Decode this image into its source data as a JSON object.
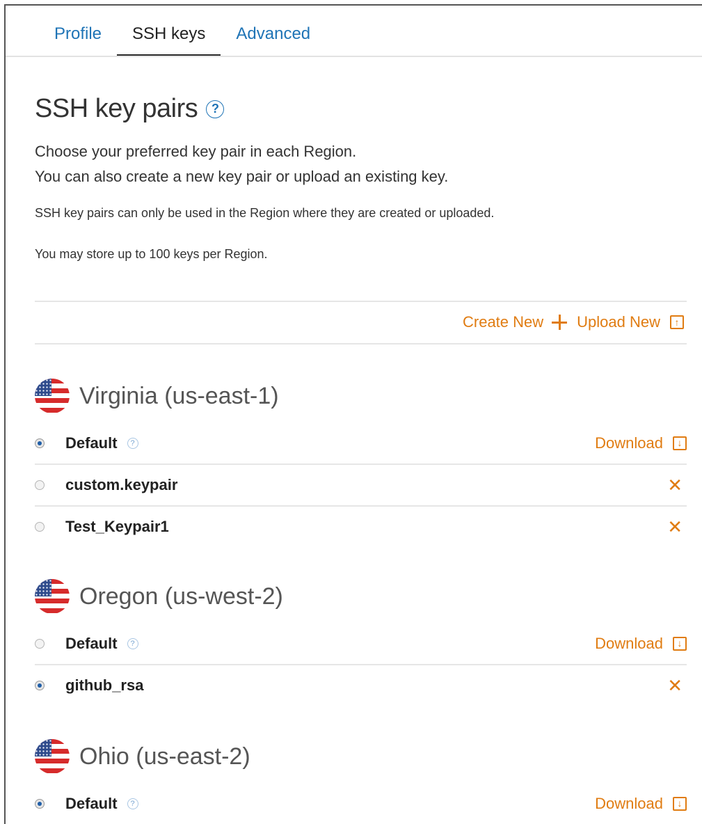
{
  "tabs": [
    {
      "label": "Profile",
      "active": false
    },
    {
      "label": "SSH keys",
      "active": true
    },
    {
      "label": "Advanced",
      "active": false
    }
  ],
  "header": {
    "title": "SSH key pairs",
    "help_glyph": "?",
    "intro_line1": "Choose your preferred key pair in each Region.",
    "intro_line2": "You can also create a new key pair or upload an existing key.",
    "note1": "SSH key pairs can only be used in the Region where they are created or uploaded.",
    "note2": "You may store up to 100 keys per Region."
  },
  "actions": {
    "create_label": "Create New",
    "upload_label": "Upload New"
  },
  "icons": {
    "plus": "plus-icon",
    "upload": "upload-icon",
    "download": "download-icon",
    "delete": "close-icon",
    "flag": "us-flag-icon",
    "help": "help-icon"
  },
  "colors": {
    "accent": "#e07c12",
    "link": "#1f74b6",
    "radio_selected": "#1f5ea8"
  },
  "regions": [
    {
      "name": "Virginia (us-east-1)",
      "keys": [
        {
          "label": "Default",
          "selected": true,
          "has_help": true,
          "action": "Download"
        },
        {
          "label": "custom.keypair",
          "selected": false,
          "has_help": false,
          "action": "delete"
        },
        {
          "label": "Test_Keypair1",
          "selected": false,
          "has_help": false,
          "action": "delete"
        }
      ]
    },
    {
      "name": "Oregon (us-west-2)",
      "keys": [
        {
          "label": "Default",
          "selected": false,
          "has_help": true,
          "action": "Download"
        },
        {
          "label": "github_rsa",
          "selected": true,
          "has_help": false,
          "action": "delete"
        }
      ]
    },
    {
      "name": "Ohio (us-east-2)",
      "keys": [
        {
          "label": "Default",
          "selected": true,
          "has_help": true,
          "action": "Download"
        }
      ]
    }
  ],
  "download_label": "Download",
  "delete_glyph": "✕"
}
